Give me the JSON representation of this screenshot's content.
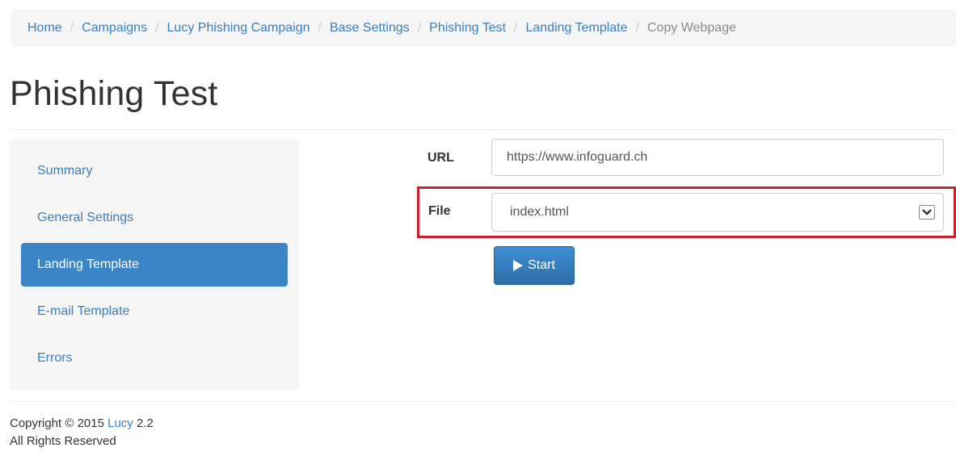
{
  "breadcrumb": {
    "items": [
      "Home",
      "Campaigns",
      "Lucy Phishing Campaign",
      "Base Settings",
      "Phishing Test",
      "Landing Template"
    ],
    "active": "Copy Webpage",
    "separator": "/"
  },
  "page": {
    "title": "Phishing Test"
  },
  "sidebar": {
    "items": [
      {
        "label": "Summary"
      },
      {
        "label": "General Settings"
      },
      {
        "label": "Landing Template"
      },
      {
        "label": "E-mail Template"
      },
      {
        "label": "Errors"
      }
    ],
    "active_index": 2
  },
  "form": {
    "url_label": "URL",
    "url_value": "https://www.infoguard.ch",
    "file_label": "File",
    "file_value": "index.html",
    "start_label": "Start"
  },
  "footer": {
    "copyright_prefix": "Copyright © 2015 ",
    "product_link": "Lucy",
    "version": " 2.2",
    "rights": "All Rights Reserved"
  },
  "colors": {
    "link": "#3a7fc0",
    "active_nav": "#3a85c6",
    "highlight_frame": "#c8202e",
    "primary_button": "#337ab7"
  },
  "icons": {
    "start_button": "play-icon",
    "file_select": "chevron-down-icon"
  }
}
